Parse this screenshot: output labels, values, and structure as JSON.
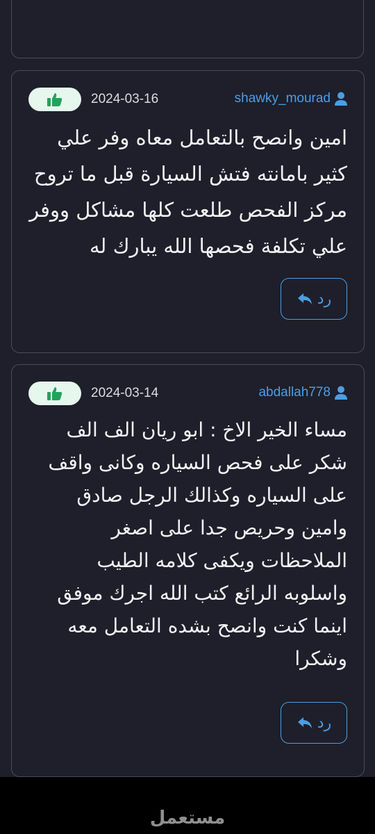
{
  "reviews": [
    {
      "author": "shawky_mourad",
      "date": "2024-03-16",
      "text": "امين وانصح بالتعامل معاه وفر علي كثير بامانته فتش السيارة قبل ما تروح مركز الفحص طلعت كلها مشاكل ووفر علي تكلفة فحصها الله يبارك له",
      "reply_label": "رد"
    },
    {
      "author": "abdallah778",
      "date": "2024-03-14",
      "text": "مساء الخير الاخ : ابو ريان الف الف شكر على فحص السياره وكانى واقف على السياره وكذالك الرجل صادق وامين وحريص جدا على اصغر الملاحظات ويكفى كلامه الطيب واسلوبه الرائع كتب الله اجرك موفق اينما كنت وانصح بشده التعامل معه وشكرا",
      "reply_label": "رد"
    }
  ],
  "watermark": "مستعمل",
  "colors": {
    "background": "#1e1f2a",
    "accent": "#4a9ee6",
    "like_bg": "#e6f7ee",
    "like_icon": "#22a35a",
    "border": "#4a4c5c"
  },
  "icons": {
    "like": "thumbs-up-icon",
    "author": "user-icon",
    "reply": "reply-arrow-icon"
  }
}
